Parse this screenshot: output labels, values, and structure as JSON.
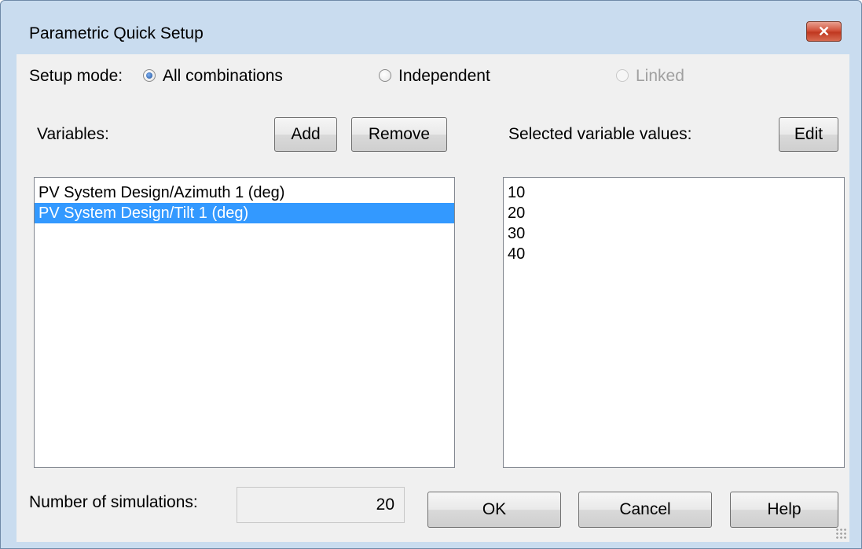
{
  "window": {
    "title": "Parametric Quick Setup"
  },
  "setup_mode": {
    "label": "Setup mode:",
    "options": [
      {
        "label": "All combinations",
        "checked": true,
        "enabled": true
      },
      {
        "label": "Independent",
        "checked": false,
        "enabled": true
      },
      {
        "label": "Linked",
        "checked": false,
        "enabled": false
      }
    ]
  },
  "variables": {
    "label": "Variables:",
    "add_label": "Add",
    "remove_label": "Remove",
    "items": [
      {
        "label": "PV System Design/Azimuth 1 (deg)",
        "selected": false
      },
      {
        "label": "PV System Design/Tilt 1 (deg)",
        "selected": true
      }
    ]
  },
  "values": {
    "label": "Selected variable values:",
    "edit_label": "Edit",
    "items": [
      "10",
      "20",
      "30",
      "40"
    ]
  },
  "footer": {
    "sim_label": "Number of simulations:",
    "sim_count": "20",
    "ok_label": "OK",
    "cancel_label": "Cancel",
    "help_label": "Help"
  },
  "colors": {
    "selection": "#3399ff",
    "frame": "#c9dcef",
    "dialog_bg": "#f0f0f0"
  }
}
